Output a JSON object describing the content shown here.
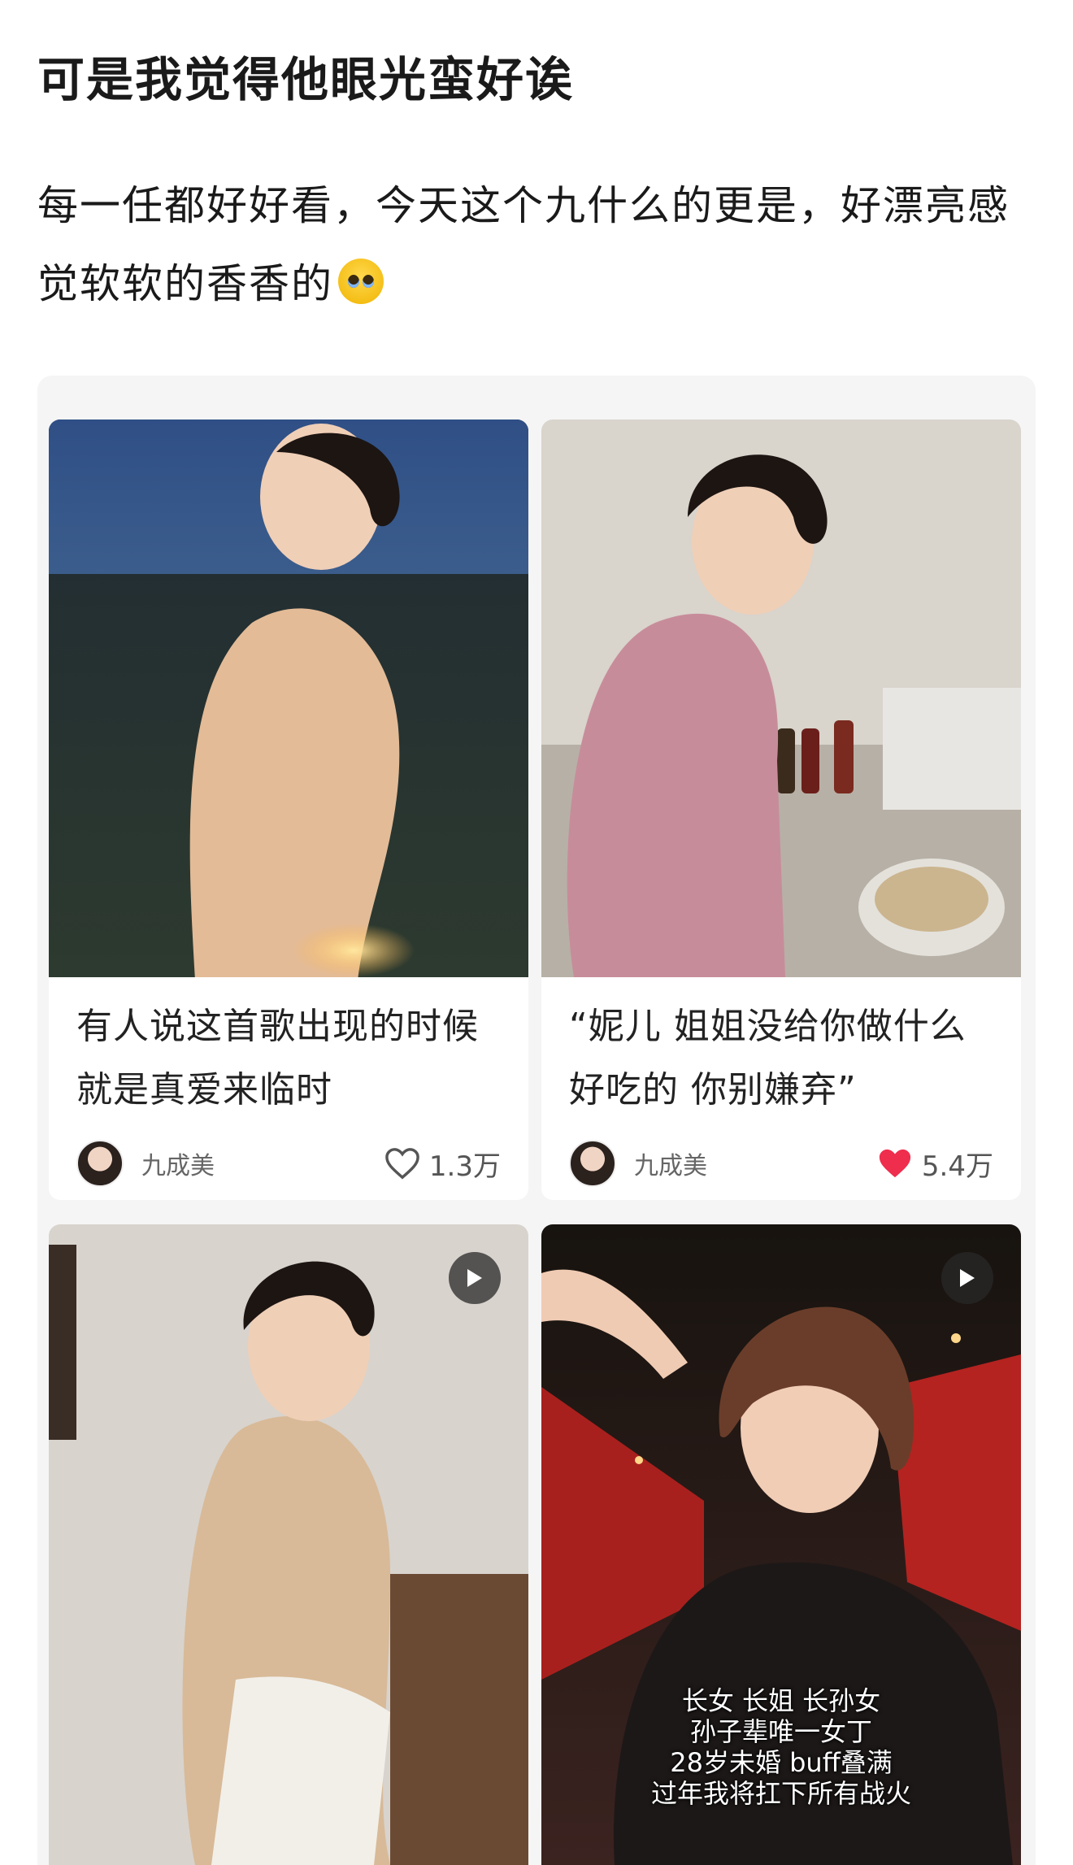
{
  "post": {
    "title": "可是我觉得他眼光蛮好诶",
    "body": "每一任都好好看，今天这个九什么的更是，好漂亮感觉软软的香香的",
    "emoji": "pleading-face"
  },
  "feed": {
    "cards": [
      {
        "caption": "有人说这首歌出现的时候 就是真爱来临时",
        "author": "九成美",
        "likes": "1.3万",
        "liked": false
      },
      {
        "caption": "“妮儿 姐姐没给你做什么好吃的 你别嫌弃”",
        "author": "九成美",
        "likes": "5.4万",
        "liked": true
      },
      {
        "is_video": true
      },
      {
        "is_video": true,
        "overlay_lines": [
          "长女 长姐 长孙女",
          "孙子辈唯一女丁",
          "28岁未婚 buff叠满",
          "过年我将扛下所有战火"
        ]
      }
    ]
  },
  "colors": {
    "like_active": "#ef2d4d",
    "like_inactive": "#555555"
  }
}
